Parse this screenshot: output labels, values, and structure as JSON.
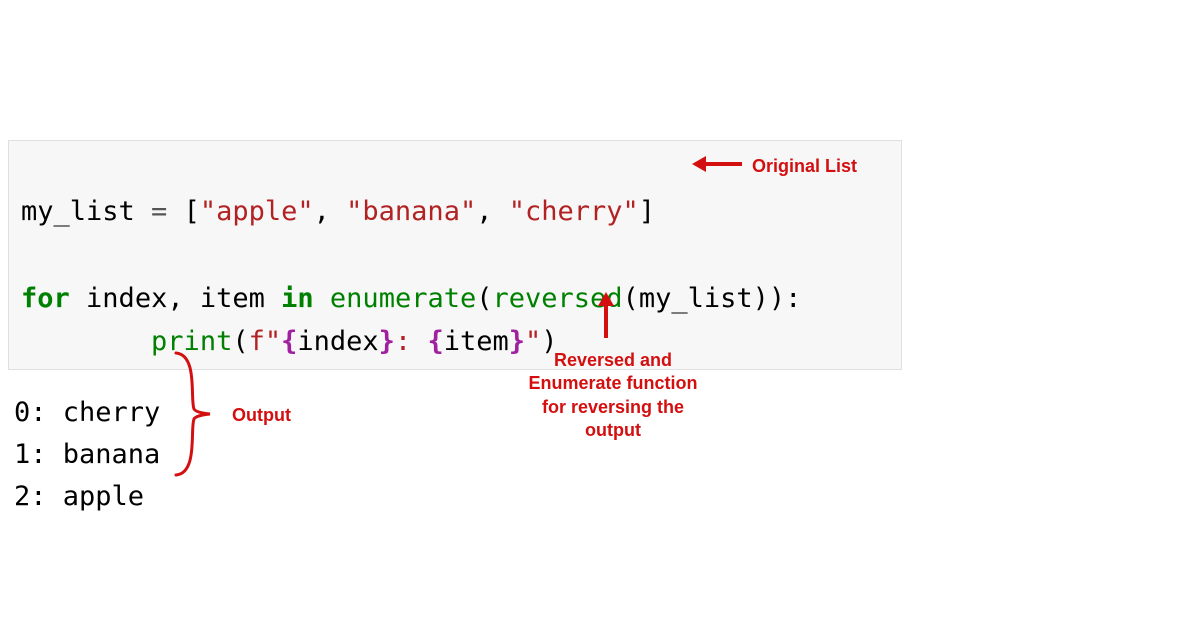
{
  "code": {
    "line1": {
      "var": "my_list",
      "eq": " = ",
      "lb": "[",
      "s1": "\"apple\"",
      "c1": ", ",
      "s2": "\"banana\"",
      "c2": ", ",
      "s3": "\"cherry\"",
      "rb": "]"
    },
    "line2": {
      "for": "for",
      "sp1": " ",
      "idx": "index",
      "comma": ", ",
      "item": "item",
      "sp2": " ",
      "in": "in",
      "sp3": " ",
      "enum": "enumerate",
      "lp1": "(",
      "rev": "reversed",
      "lp2": "(",
      "arg": "my_list",
      "rp": ")):"
    },
    "line3": {
      "indent": "        ",
      "print": "print",
      "lp": "(",
      "fprefix": "f\"",
      "iopen1": "{",
      "ivar1": "index",
      "iclose1": "}",
      "sep": ": ",
      "iopen2": "{",
      "ivar2": "item",
      "iclose2": "}",
      "fclose": "\"",
      "rp": ")"
    }
  },
  "output": {
    "l1": "0: cherry",
    "l2": "1: banana",
    "l3": "2: apple"
  },
  "annot": {
    "original_list": "Original List",
    "reversed_fn_l1": "Reversed and",
    "reversed_fn_l2": "Enumerate function",
    "reversed_fn_l3": "for reversing the",
    "reversed_fn_l4": "output",
    "output_label": "Output"
  }
}
